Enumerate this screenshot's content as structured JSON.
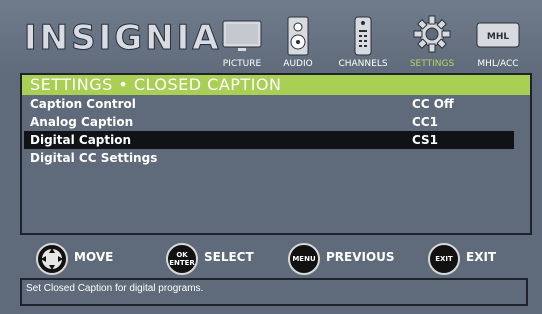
{
  "brand": "INSIGNIA",
  "tabs": [
    {
      "label": "PICTURE",
      "icon": "tv-icon",
      "active": false
    },
    {
      "label": "AUDIO",
      "icon": "speaker-icon",
      "active": false
    },
    {
      "label": "CHANNELS",
      "icon": "remote-icon",
      "active": false
    },
    {
      "label": "SETTINGS",
      "icon": "gear-icon",
      "active": true
    },
    {
      "label": "MHL/ACC",
      "icon": "mhl-icon",
      "badge": "MHL",
      "active": false
    }
  ],
  "panel": {
    "title": "SETTINGS • CLOSED CAPTION",
    "rows": [
      {
        "label": "Caption Control",
        "value": "CC Off",
        "selected": false
      },
      {
        "label": "Analog Caption",
        "value": "CC1",
        "selected": false
      },
      {
        "label": "Digital Caption",
        "value": "CS1",
        "selected": true
      },
      {
        "label": "Digital CC Settings",
        "value": "",
        "selected": false
      }
    ]
  },
  "hints": [
    {
      "button": "",
      "label": "MOVE",
      "icon": "dpad-icon"
    },
    {
      "button": "OK ENTER",
      "label": "SELECT",
      "icon": "ok-enter-icon"
    },
    {
      "button": "MENU",
      "label": "PREVIOUS",
      "icon": "menu-button-icon"
    },
    {
      "button": "EXIT",
      "label": "EXIT",
      "icon": "exit-button-icon"
    }
  ],
  "help_text": "Set Closed Caption for digital programs.",
  "colors": {
    "accent": "#a9cf54",
    "background": "#5f6b7a",
    "selected_row": "#101216"
  }
}
